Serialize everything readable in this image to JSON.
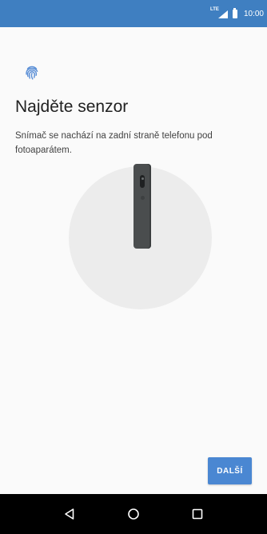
{
  "status_bar": {
    "network_label": "LTE",
    "time": "10:00",
    "icons": [
      "lte-icon",
      "signal-icon",
      "battery-icon"
    ]
  },
  "content": {
    "icon": "fingerprint-icon",
    "title": "Najděte senzor",
    "description": "Snímač se nachází na zadní straně telefonu pod fotoaparátem."
  },
  "illustration": {
    "icon": "phone-back-illustration"
  },
  "actions": {
    "next_label": "DALŠÍ"
  },
  "navigation": {
    "icons": [
      "back-icon",
      "home-icon",
      "recents-icon"
    ]
  },
  "colors": {
    "status_bar": "#3f7fc1",
    "accent": "#4a87d2",
    "fingerprint": "#5b8fd6",
    "background": "#fafafa",
    "circle": "#ececec",
    "phone": "#4a4d4e",
    "nav_bar": "#000000"
  }
}
